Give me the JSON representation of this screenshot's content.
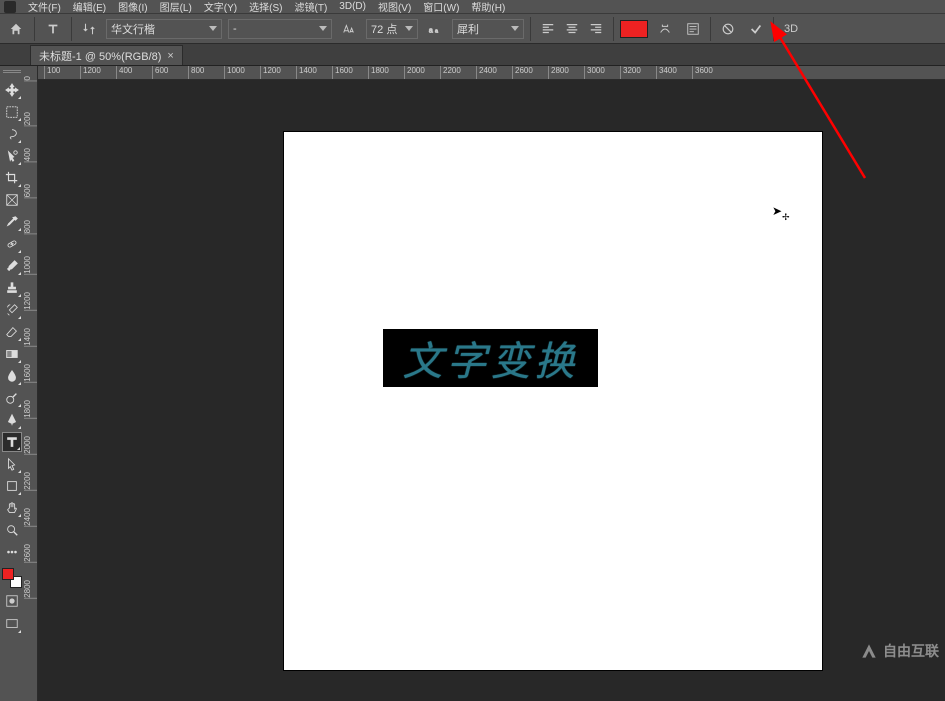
{
  "menu": {
    "items": [
      "文件(F)",
      "编辑(E)",
      "图像(I)",
      "图层(L)",
      "文字(Y)",
      "选择(S)",
      "滤镜(T)",
      "3D(D)",
      "视图(V)",
      "窗口(W)",
      "帮助(H)"
    ]
  },
  "options": {
    "font_family": "华文行楷",
    "font_style": "-",
    "font_size_value": "72",
    "font_size_unit": "点",
    "aa_method": "犀利",
    "color_swatch": "#ee2222",
    "threeD": "3D"
  },
  "tab": {
    "title": "未标题-1 @ 50%(RGB/8)",
    "close": "×"
  },
  "ruler": {
    "h": [
      "100",
      "1200",
      "400",
      "600",
      "800",
      "1000",
      "1200",
      "1400",
      "1600",
      "1800",
      "2000",
      "2200",
      "2400",
      "2600",
      "2800",
      "3000",
      "3200",
      "3400",
      "3600"
    ],
    "h_positions": [
      14,
      50,
      86,
      122,
      158,
      194,
      230,
      266,
      302,
      338,
      374,
      410,
      446,
      482,
      518,
      554,
      590,
      626,
      662
    ],
    "v": [
      "0",
      "200",
      "400",
      "600",
      "800",
      "1000",
      "1200",
      "1400",
      "1600",
      "1800",
      "2000",
      "2200",
      "2400",
      "2600",
      "2800"
    ],
    "v_positions_approx": [
      10,
      46,
      82,
      118,
      154,
      190,
      226,
      262,
      298,
      334,
      370,
      406,
      442,
      478,
      514
    ]
  },
  "canvas": {
    "text_content": "文字变换",
    "text_color": "#2a788a",
    "text_bg": "#000000"
  },
  "watermark": {
    "text": "自由互联"
  },
  "annotation": {
    "arrow_color": "#ff0000"
  }
}
